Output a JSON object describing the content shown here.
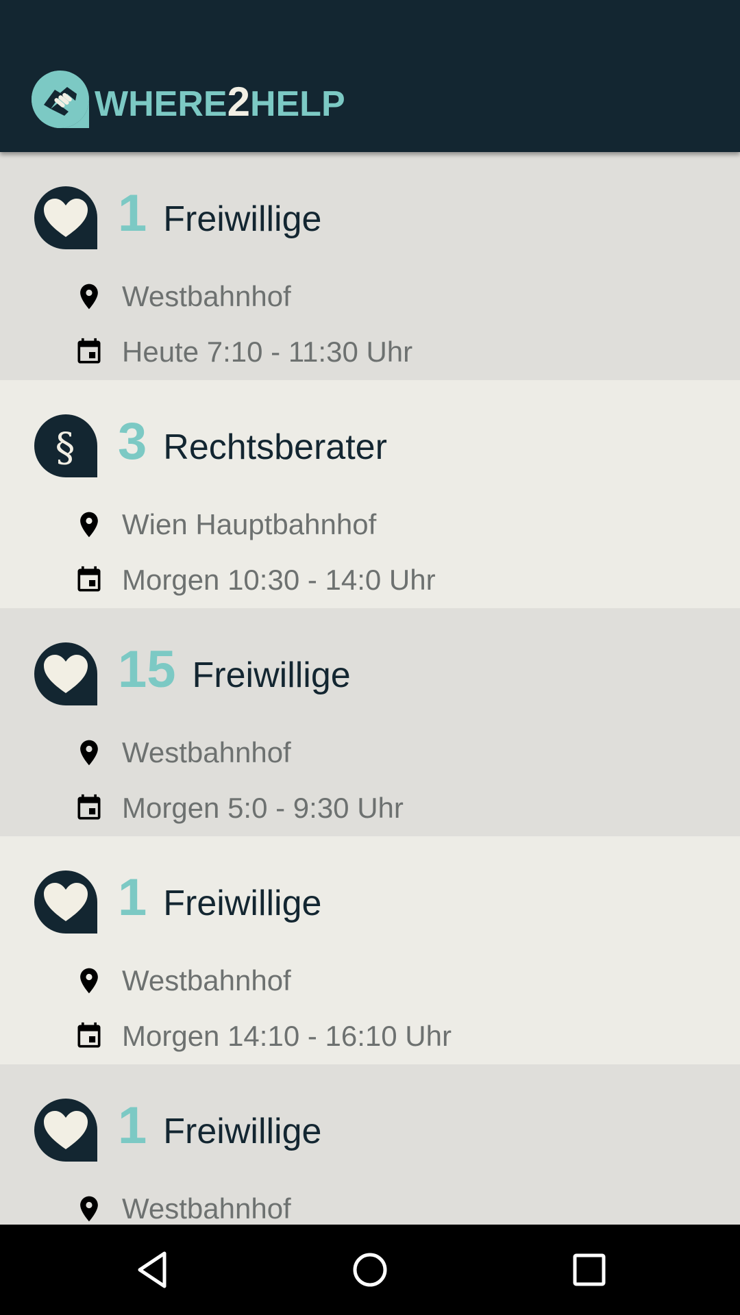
{
  "app": {
    "brand_part1": "WHERE",
    "brand_part2": "2",
    "brand_part3": "HELP",
    "logo_icon": "handshake-icon",
    "accent_color": "#7cc9c4",
    "bar_color": "#132631"
  },
  "needs": [
    {
      "icon": "heart-icon",
      "count": "1",
      "role": "Freiwillige",
      "location": "Westbahnhof",
      "time": "Heute 7:10 - 11:30 Uhr"
    },
    {
      "icon": "paragraph-icon",
      "count": "3",
      "role": "Rechtsberater",
      "location": "Wien Hauptbahnhof",
      "time": "Morgen 10:30 - 14:0 Uhr"
    },
    {
      "icon": "heart-icon",
      "count": "15",
      "role": "Freiwillige",
      "location": "Westbahnhof",
      "time": "Morgen 5:0 - 9:30 Uhr"
    },
    {
      "icon": "heart-icon",
      "count": "1",
      "role": "Freiwillige",
      "location": "Westbahnhof",
      "time": "Morgen 14:10 - 16:10 Uhr"
    },
    {
      "icon": "heart-icon",
      "count": "1",
      "role": "Freiwillige",
      "location": "Westbahnhof",
      "time": ""
    }
  ],
  "system_nav": [
    "back-icon",
    "home-icon",
    "recents-icon"
  ]
}
